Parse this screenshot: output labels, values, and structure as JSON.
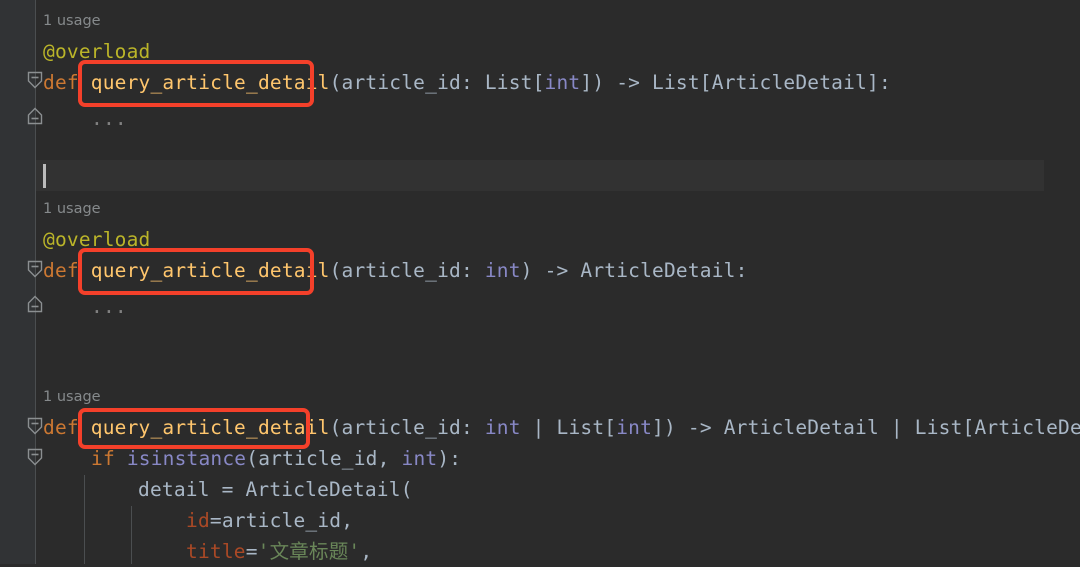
{
  "editor": {
    "background": "#2b2b2b",
    "gutter_background": "#313335",
    "caret_line_background": "#323232",
    "annotation_color": "#f4402a",
    "default_text_color": "#a9b7c6"
  },
  "hints": {
    "usage_1": "1 usage",
    "usage_2": "1 usage",
    "usage_3": "1 usage"
  },
  "code": {
    "block1": {
      "decorator": "@overload",
      "def_kw": "def",
      "fn_name": "query_article_detail",
      "paren_open": "(",
      "param_name": "article_id",
      "colon_sp": ": ",
      "ann_list_open": "List[",
      "ann_int": "int",
      "ann_list_close": "]",
      "paren_close": ")",
      "arrow": " -> ",
      "ret_list_open": "List[",
      "ret_type": "ArticleDetail",
      "ret_list_close": "]",
      "end_colon": ":",
      "body_ellipsis": "..."
    },
    "block2": {
      "decorator": "@overload",
      "def_kw": "def",
      "fn_name": "query_article_detail",
      "paren_open": "(",
      "param_name": "article_id",
      "colon_sp": ": ",
      "ann_int": "int",
      "paren_close": ")",
      "arrow": " -> ",
      "ret_type": "ArticleDetail",
      "end_colon": ":",
      "body_ellipsis": "..."
    },
    "block3": {
      "def_kw": "def",
      "fn_name": "query_article_detail",
      "paren_open": "(",
      "param_name": "article_id",
      "colon_sp": ": ",
      "ann_int": "int",
      "union_pipe": " | ",
      "ann_list_open": "List[",
      "ann_list_int": "int",
      "ann_list_close": "]",
      "paren_close": ")",
      "arrow": " -> ",
      "ret_type_a": "ArticleDetail",
      "ret_union_pipe": " | ",
      "ret_list_open": "List[",
      "ret_type_b": "ArticleDetail",
      "ret_list_close": "]",
      "end_colon": ":",
      "if_kw": "if",
      "isinstance_fn": "isinstance",
      "isinstance_open": "(",
      "isinstance_arg": "article_id",
      "isinstance_comma": ", ",
      "isinstance_type": "int",
      "isinstance_close": ")",
      "if_colon": ":",
      "assign_name": "detail",
      "assign_eq": " = ",
      "ctor_name": "ArticleDetail",
      "ctor_open": "(",
      "kw_id": "id",
      "kw_id_eq": "=",
      "kw_id_val": "article_id",
      "kw_id_comma": ",",
      "kw_title": "title",
      "kw_title_eq": "=",
      "kw_title_val": "'文章标题'",
      "kw_title_comma": ","
    }
  },
  "annotations": {
    "box1_label": "query_article_detail",
    "box2_label": "query_article_detail",
    "box3_label": "query_article_detail"
  },
  "fold_markers": {
    "expanded_glyph": "minus"
  }
}
